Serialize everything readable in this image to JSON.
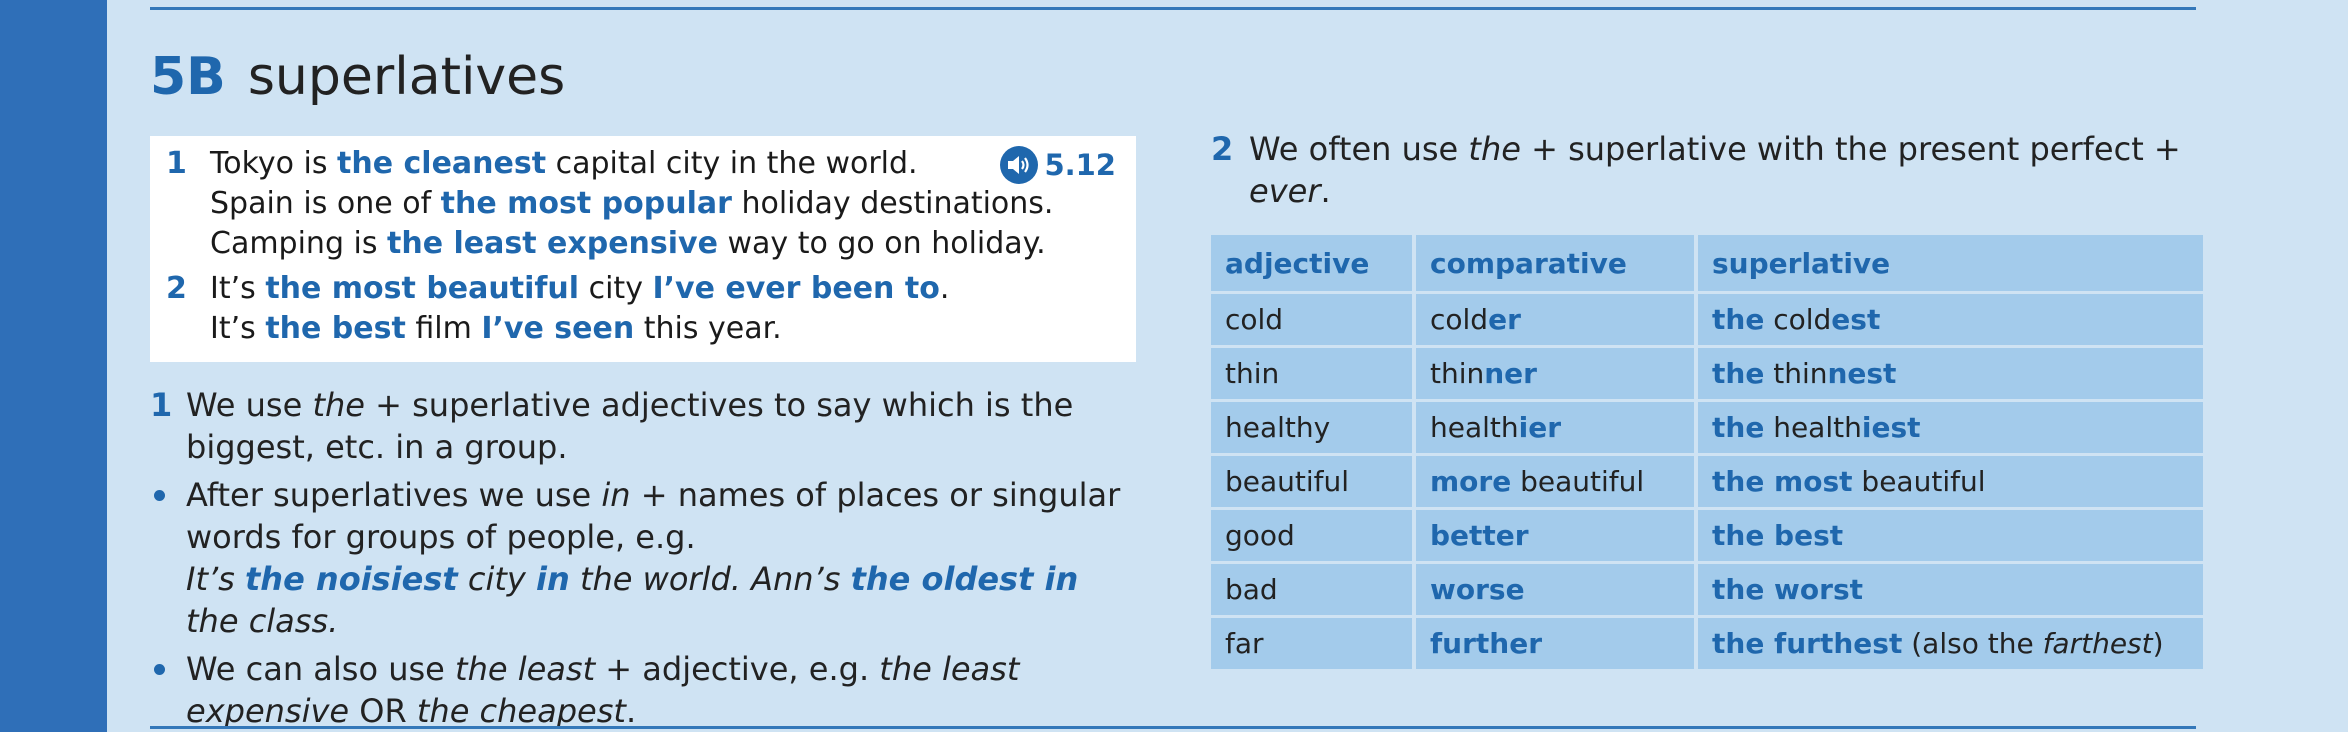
{
  "section": {
    "code": "5B",
    "title": "superlatives"
  },
  "audio": {
    "track": "5.12"
  },
  "examples": [
    {
      "num": "1",
      "lines": [
        [
          {
            "t": "Tokyo is "
          },
          {
            "t": "the cleanest",
            "b": true
          },
          {
            "t": " capital city in the world."
          }
        ],
        [
          {
            "t": "Spain is one of "
          },
          {
            "t": "the most popular",
            "b": true
          },
          {
            "t": " holiday destinations."
          }
        ],
        [
          {
            "t": "Camping is "
          },
          {
            "t": "the least expensive",
            "b": true
          },
          {
            "t": " way to go on holiday."
          }
        ]
      ]
    },
    {
      "num": "2",
      "lines": [
        [
          {
            "t": "It’s "
          },
          {
            "t": "the most beautiful",
            "b": true
          },
          {
            "t": " city "
          },
          {
            "t": "I’ve ever been to",
            "b": true
          },
          {
            "t": "."
          }
        ],
        [
          {
            "t": "It’s "
          },
          {
            "t": "the best",
            "b": true
          },
          {
            "t": " film "
          },
          {
            "t": "I’ve seen",
            "b": true
          },
          {
            "t": " this year."
          }
        ]
      ]
    }
  ],
  "rules": {
    "rule1_number": "1",
    "rule1_text": [
      {
        "t": "We use "
      },
      {
        "t": "the",
        "i": true
      },
      {
        "t": " + superlative adjectives to say which is the biggest, etc. in a group."
      }
    ],
    "bullet1_text": [
      {
        "t": "After superlatives we use "
      },
      {
        "t": "in",
        "i": true
      },
      {
        "t": " + names of places or singular words for groups of people, e.g."
      },
      {
        "br": true
      },
      {
        "t": "It’s ",
        "i": true
      },
      {
        "t": "the noisiest",
        "i": true,
        "b": true
      },
      {
        "t": " city ",
        "i": true
      },
      {
        "t": "in",
        "i": true,
        "b": true
      },
      {
        "t": " the world. Ann’s ",
        "i": true
      },
      {
        "t": "the oldest in",
        "i": true,
        "b": true
      },
      {
        "t": " the class.",
        "i": true
      }
    ],
    "bullet2_text": [
      {
        "t": "We can also use "
      },
      {
        "t": "the least",
        "i": true
      },
      {
        "t": " + adjective, e.g. "
      },
      {
        "t": "the least expensive",
        "i": true
      },
      {
        "t": " OR "
      },
      {
        "t": "the cheapest",
        "i": true
      },
      {
        "t": "."
      }
    ],
    "rule2_number": "2",
    "rule2_text": [
      {
        "t": "We often use "
      },
      {
        "t": "the",
        "i": true
      },
      {
        "t": " + superlative with the present perfect + "
      },
      {
        "t": "ever",
        "i": true
      },
      {
        "t": "."
      }
    ]
  },
  "table": {
    "headers": [
      "adjective",
      "comparative",
      "superlative"
    ],
    "rows": [
      [
        [
          {
            "t": "cold"
          }
        ],
        [
          {
            "t": "cold"
          },
          {
            "t": "er",
            "b": true
          }
        ],
        [
          {
            "t": "the",
            "b": true
          },
          {
            "t": " cold"
          },
          {
            "t": "est",
            "b": true
          }
        ]
      ],
      [
        [
          {
            "t": "thin"
          }
        ],
        [
          {
            "t": "thin"
          },
          {
            "t": "ner",
            "b": true
          }
        ],
        [
          {
            "t": "the",
            "b": true
          },
          {
            "t": " thin"
          },
          {
            "t": "nest",
            "b": true
          }
        ]
      ],
      [
        [
          {
            "t": "healthy"
          }
        ],
        [
          {
            "t": "health"
          },
          {
            "t": "ier",
            "b": true
          }
        ],
        [
          {
            "t": "the",
            "b": true
          },
          {
            "t": " health"
          },
          {
            "t": "iest",
            "b": true
          }
        ]
      ],
      [
        [
          {
            "t": "beautiful"
          }
        ],
        [
          {
            "t": "more",
            "b": true
          },
          {
            "t": " beautiful"
          }
        ],
        [
          {
            "t": "the most",
            "b": true
          },
          {
            "t": " beautiful"
          }
        ]
      ],
      [
        [
          {
            "t": "good"
          }
        ],
        [
          {
            "t": "better",
            "b": true
          }
        ],
        [
          {
            "t": "the best",
            "b": true
          }
        ]
      ],
      [
        [
          {
            "t": "bad"
          }
        ],
        [
          {
            "t": "worse",
            "b": true
          }
        ],
        [
          {
            "t": "the worst",
            "b": true
          }
        ]
      ],
      [
        [
          {
            "t": "far"
          }
        ],
        [
          {
            "t": "further",
            "b": true
          }
        ],
        [
          {
            "t": "the furthest",
            "b": true
          },
          {
            "t": " (also the "
          },
          {
            "t": "farthest",
            "i": true
          },
          {
            "t": ")"
          }
        ]
      ]
    ]
  }
}
